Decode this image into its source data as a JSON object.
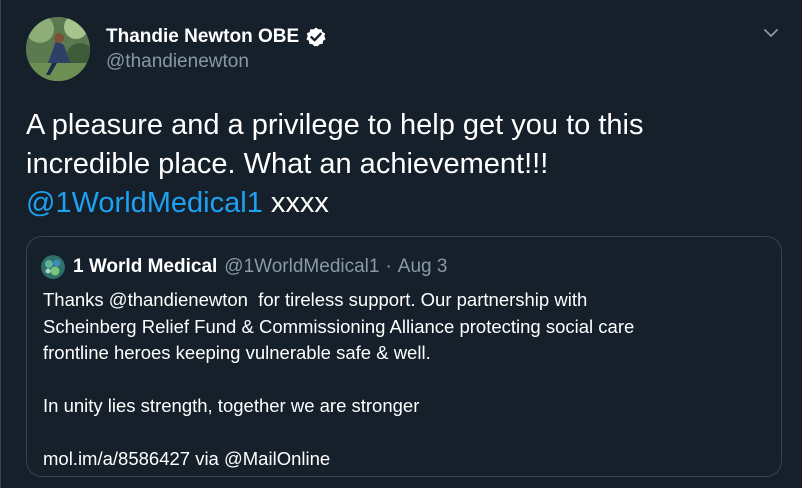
{
  "author": {
    "display_name": "Thandie Newton OBE",
    "handle": "@thandienewton",
    "verified_icon": "verified-badge-icon"
  },
  "menu_icon": "chevron-down-icon",
  "tweet": {
    "line1": "A pleasure and a privilege to help get you to this",
    "line2": "incredible place. What an achievement!!!",
    "mention": "@1WorldMedical1",
    "trailing": " xxxx"
  },
  "quoted_tweet": {
    "display_name": "1 World Medical",
    "handle": "@1WorldMedical1",
    "separator": "·",
    "date": "Aug 3",
    "lines": [
      "Thanks @thandienewton  for tireless support. Our partnership with",
      "Scheinberg Relief Fund & Commissioning Alliance protecting social care",
      "frontline heroes keeping vulnerable safe & well."
    ],
    "line_unity": "In unity lies strength, together we are stronger",
    "line_link": "mol.im/a/8586427 via @MailOnline"
  },
  "colors": {
    "background": "#15202b",
    "link": "#1da1f2",
    "secondary_text": "#8899a6",
    "border": "#38444d"
  }
}
